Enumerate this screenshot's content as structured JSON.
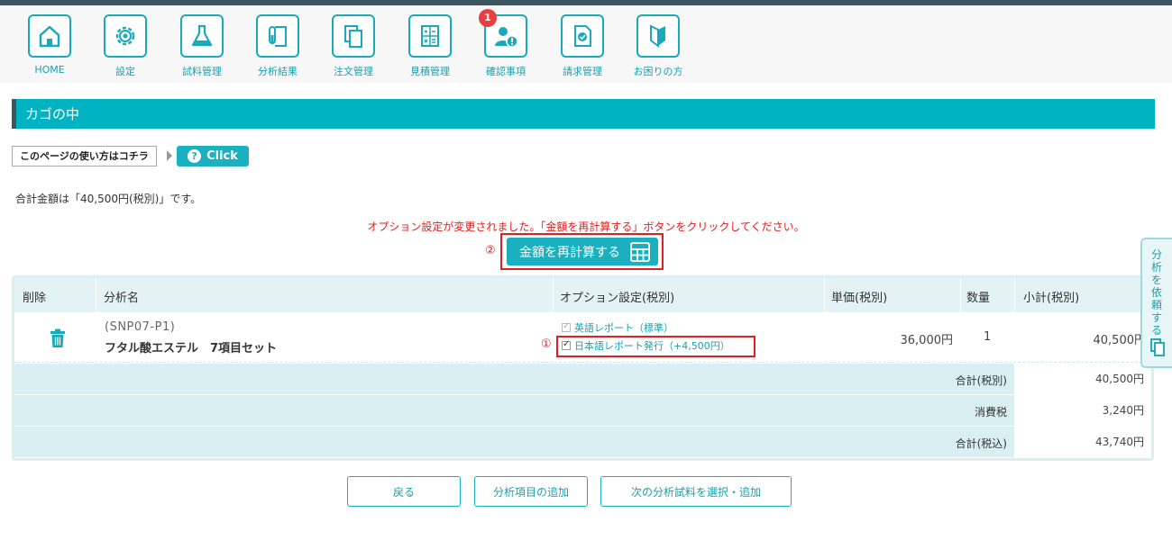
{
  "nav": {
    "items": [
      {
        "label": "HOME",
        "icon": "home-icon"
      },
      {
        "label": "設定",
        "icon": "gear-icon"
      },
      {
        "label": "試料管理",
        "icon": "flask-icon"
      },
      {
        "label": "分析結果",
        "icon": "test-tube-document-icon"
      },
      {
        "label": "注文管理",
        "icon": "copy-documents-icon"
      },
      {
        "label": "見積管理",
        "icon": "calculator-icon"
      },
      {
        "label": "確認事項",
        "icon": "user-alert-icon",
        "badge": "1"
      },
      {
        "label": "請求管理",
        "icon": "invoice-check-icon"
      },
      {
        "label": "お困りの方",
        "icon": "beginner-mark-icon"
      }
    ]
  },
  "section_title": "カゴの中",
  "help": {
    "label": "このページの使い方はコチラ",
    "click_label": "Click",
    "click_icon": "question-icon"
  },
  "total_text": "合計金額は「40,500円(税別)」です。",
  "notice": "オプション設定が変更されました。「金額を再計算する」ボタンをクリックしてください。",
  "recalc": {
    "marker": "②",
    "label": "金額を再計算する",
    "icon": "calculator-icon"
  },
  "table": {
    "headers": {
      "delete": "削除",
      "name": "分析名",
      "options": "オプション設定(税別)",
      "unit_price": "単価(税別)",
      "quantity": "数量",
      "subtotal": "小計(税別)"
    },
    "rows": [
      {
        "sku": "(SNP07-P1)",
        "name": "フタル酸エステル　7項目セット",
        "options": [
          {
            "label": "英語レポート（標準）",
            "checked": true,
            "disabled": true
          },
          {
            "label": "日本語レポート発行（+4,500円）",
            "checked": true,
            "disabled": false,
            "marker": "①"
          }
        ],
        "unit_price": "36,000円",
        "quantity": "1",
        "subtotal": "40,500円"
      }
    ],
    "summary": [
      {
        "label": "合計(税別)",
        "value": "40,500円"
      },
      {
        "label": "消費税",
        "value": "3,240円"
      },
      {
        "label": "合計(税込)",
        "value": "43,740円"
      }
    ]
  },
  "buttons": {
    "back": "戻る",
    "add_item": "分析項目の追加",
    "next_sample": "次の分析試料を選択・追加"
  },
  "side_tab": {
    "label": "分析を依頼する",
    "icon": "copy-icon"
  },
  "colors": {
    "accent": "#00b3c3",
    "dark": "#3a5661",
    "alert": "#e02020",
    "badge": "#e84040"
  }
}
